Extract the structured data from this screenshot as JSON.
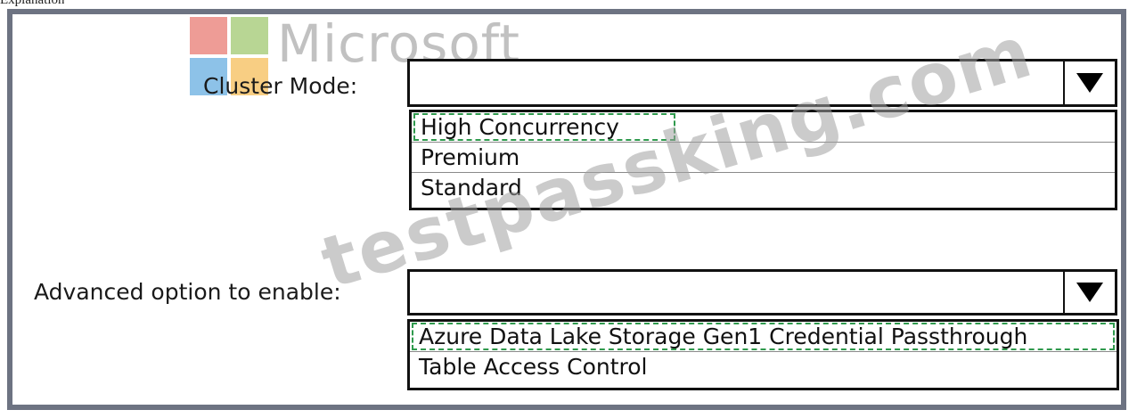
{
  "page_label": "Explanation",
  "watermark_logo": {
    "word": "Microsoft"
  },
  "watermark_text": "testpassking.com",
  "cluster_mode": {
    "label": "Cluster Mode:",
    "selected": "",
    "options": [
      "High Concurrency",
      "Premium",
      "Standard"
    ]
  },
  "advanced_option": {
    "label": "Advanced option to enable:",
    "selected": "",
    "options": [
      "Azure Data Lake Storage Gen1 Credential Passthrough",
      "Table Access Control"
    ]
  },
  "colors": {
    "panel_border": "#6d7382",
    "highlight_dashed": "#2f9a4d"
  },
  "icons": {
    "dropdown_arrow": "triangle-down-icon"
  }
}
